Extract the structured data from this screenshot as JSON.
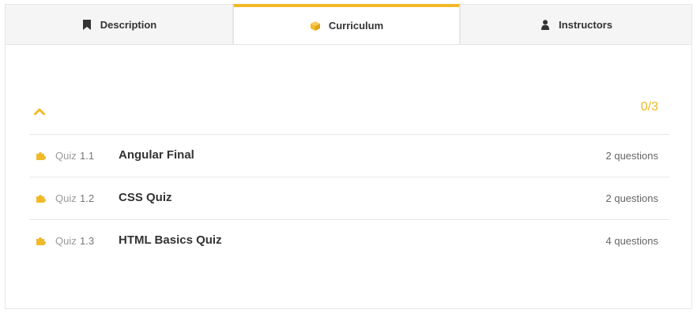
{
  "tabs": [
    {
      "label": "Description",
      "icon": "bookmark-icon"
    },
    {
      "label": "Curriculum",
      "icon": "box-icon"
    },
    {
      "label": "Instructors",
      "icon": "user-icon"
    }
  ],
  "accent_color": "#f2b927",
  "section": {
    "progress": "0/3"
  },
  "items": [
    {
      "type": "Quiz",
      "number": "1.1",
      "title": "Angular Final",
      "meta": "2 questions"
    },
    {
      "type": "Quiz",
      "number": "1.2",
      "title": "CSS Quiz",
      "meta": "2 questions"
    },
    {
      "type": "Quiz",
      "number": "1.3",
      "title": "HTML Basics Quiz",
      "meta": "4 questions"
    }
  ]
}
